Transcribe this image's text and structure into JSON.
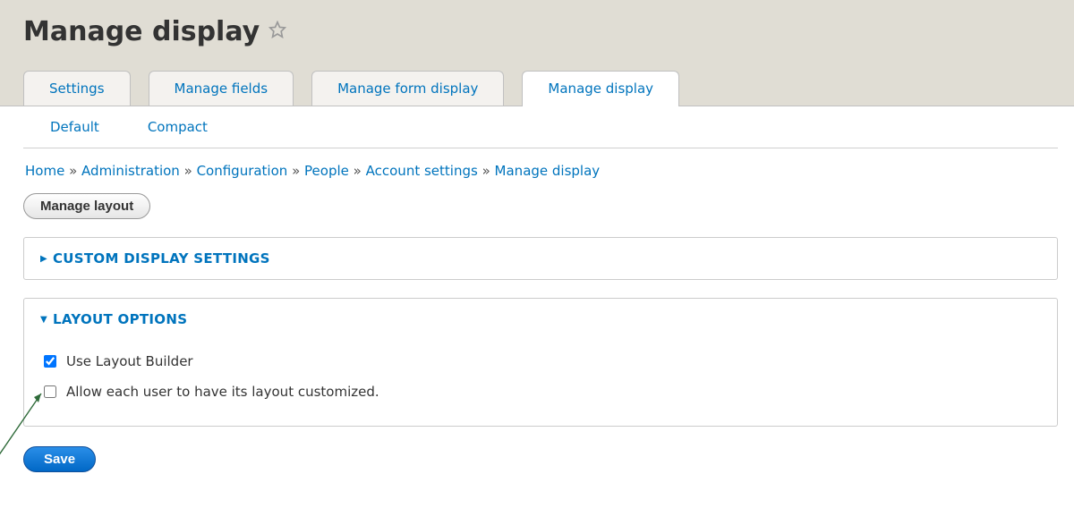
{
  "header": {
    "title": "Manage display"
  },
  "tabs_primary": [
    {
      "label": "Settings",
      "active": false
    },
    {
      "label": "Manage fields",
      "active": false
    },
    {
      "label": "Manage form display",
      "active": false
    },
    {
      "label": "Manage display",
      "active": true
    }
  ],
  "tabs_secondary": [
    {
      "label": "Default"
    },
    {
      "label": "Compact"
    }
  ],
  "breadcrumb": {
    "items": [
      "Home",
      "Administration",
      "Configuration",
      "People",
      "Account settings",
      "Manage display"
    ],
    "separator": "»"
  },
  "buttons": {
    "manage_layout": "Manage layout",
    "save": "Save"
  },
  "fieldsets": {
    "custom_display": {
      "title": "CUSTOM DISPLAY SETTINGS",
      "open": false
    },
    "layout_options": {
      "title": "LAYOUT OPTIONS",
      "open": true,
      "checkboxes": [
        {
          "label": "Use Layout Builder",
          "checked": true
        },
        {
          "label": "Allow each user to have its layout customized.",
          "checked": false
        }
      ]
    }
  }
}
